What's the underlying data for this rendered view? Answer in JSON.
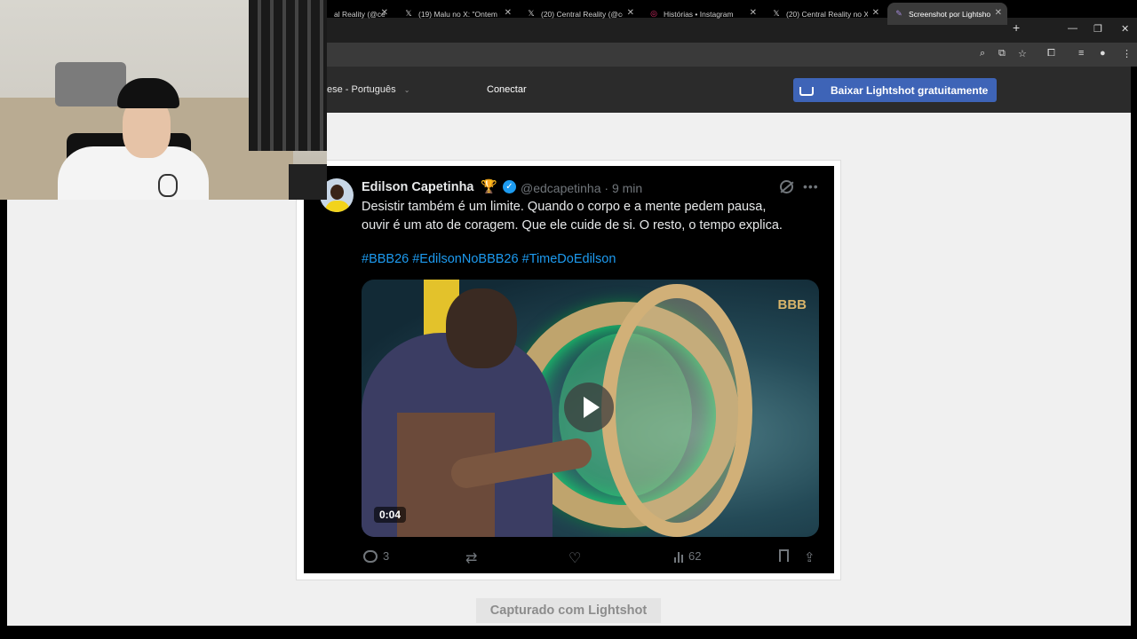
{
  "browser": {
    "tabs": [
      {
        "title": "al Reality (@ce",
        "icon": "x-logo-icon",
        "active": false
      },
      {
        "title": "(19) Malu no X: \"Ontem n",
        "icon": "x-logo-icon",
        "active": false
      },
      {
        "title": "(20) Central Reality (@ce",
        "icon": "x-logo-icon",
        "active": false
      },
      {
        "title": "Histórias • Instagram",
        "icon": "instagram-icon",
        "active": false
      },
      {
        "title": "(20) Central Reality no X:",
        "icon": "x-logo-icon",
        "active": false
      },
      {
        "title": "Screenshot por Lightshot",
        "icon": "lightshot-feather-icon",
        "active": true
      }
    ],
    "close_glyph": "✕",
    "new_tab_glyph": "+"
  },
  "lightshot": {
    "language": "ese - Português",
    "connect": "Conectar",
    "download_button": "Baixar Lightshot gratuitamente",
    "captured_label": "Capturado com Lightshot"
  },
  "tweet": {
    "author_name": "Edilson Capetinha",
    "author_badge_emoji": "🏆",
    "handle_time": "@edcapetinha · 9 min",
    "text_line1": "Desistir também é um limite. Quando o corpo e a mente pedem pausa,",
    "text_line2": "ouvir é um ato de coragem. Que ele cuide de si. O resto, o tempo explica.",
    "hashtags": "#BBB26 #EdilsonNoBBB26 #TimeDoEdilson",
    "video_duration": "0:04",
    "video_watermark": "BBB",
    "replies": "3",
    "views": "62"
  },
  "colors": {
    "twitter_blue": "#1d9bf0",
    "lightshot_button": "#3e64b7",
    "tweet_bg": "#000000",
    "muted_text": "#71767b"
  }
}
